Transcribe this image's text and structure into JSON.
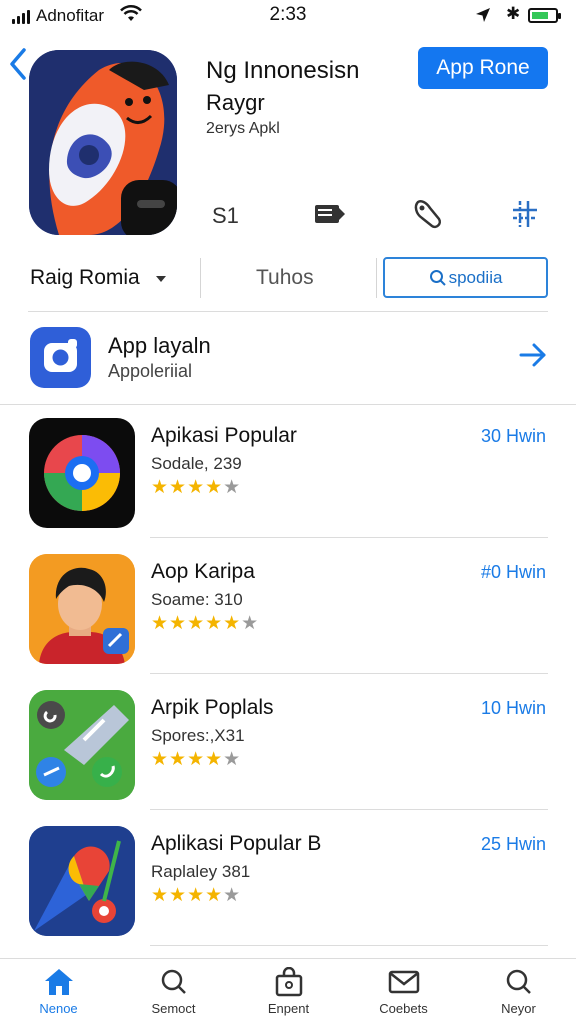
{
  "status_bar": {
    "carrier": "Adnofitar",
    "time": "2:33",
    "battery_level": 0.6
  },
  "header": {
    "app_title": "Ng Innonesisn",
    "app_subtitle": "Raygr",
    "developer": "2erys Apkl",
    "get_button": "App Rone",
    "meta_icons": [
      "currency-icon",
      "card-icon",
      "tag-icon",
      "grid-icon"
    ],
    "meta_first_label": "S1"
  },
  "filter": {
    "left_label": "Raig Romia",
    "middle_label": "Tuhos",
    "search_label": "spodiia"
  },
  "featured": {
    "title": "App layaln",
    "subtitle": "Appoleriial"
  },
  "apps": [
    {
      "name": "Apikasi Popular",
      "meta": "Sodale, 239",
      "rating": 4,
      "action": "30 Hwin",
      "icon": "spiral-app-icon"
    },
    {
      "name": "Aop Karipa",
      "meta": "Soame: 310",
      "rating": 5,
      "action": "#0 Hwin",
      "icon": "avatar-app-icon"
    },
    {
      "name": "Arpik Poplals",
      "meta": "Spores:,X31",
      "rating": 4,
      "action": "10 Hwin",
      "icon": "tools-app-icon"
    },
    {
      "name": "Aplikasi Popular B",
      "meta": "Raplaley 381",
      "rating": 4,
      "action": "25 Hwin",
      "icon": "map-pin-app-icon"
    }
  ],
  "tabs": [
    {
      "label": "Nenoe",
      "icon": "home-icon",
      "active": true
    },
    {
      "label": "Semoct",
      "icon": "search-icon",
      "active": false
    },
    {
      "label": "Enpent",
      "icon": "bag-icon",
      "active": false
    },
    {
      "label": "Coebets",
      "icon": "mail-icon",
      "active": false
    },
    {
      "label": "Neyor",
      "icon": "search-icon",
      "active": false
    }
  ],
  "colors": {
    "accent": "#1a7be6",
    "button": "#1477f0",
    "star": "#f4b400"
  }
}
